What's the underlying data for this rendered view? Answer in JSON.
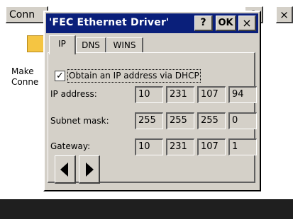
{
  "background": {
    "button_label": "Conn",
    "mid_button_label": "?",
    "close_label": "×",
    "icon_label_line1": "Make",
    "icon_label_line2": "Conne"
  },
  "dialog": {
    "title": "'FEC Ethernet Driver'",
    "help_label": "?",
    "ok_label": "OK",
    "close_label": "×"
  },
  "tabs": [
    {
      "label": "IP",
      "active": true
    },
    {
      "label": "DNS",
      "active": false
    },
    {
      "label": "WINS",
      "active": false
    }
  ],
  "dhcp": {
    "label": "Obtain an IP address via DHCP",
    "checked": true,
    "check_mark": "✓"
  },
  "fields": {
    "ip": {
      "label": "IP address:",
      "octets": [
        "10",
        "231",
        "107",
        "94"
      ]
    },
    "mask": {
      "label": "Subnet mask:",
      "octets": [
        "255",
        "255",
        "255",
        "0"
      ]
    },
    "gateway": {
      "label": "Gateway:",
      "octets": [
        "10",
        "231",
        "107",
        "1"
      ]
    }
  },
  "nav": {
    "prev_icon": "left-arrow-icon",
    "next_icon": "right-arrow-icon"
  },
  "colors": {
    "title_bar": "#0a1f7a",
    "dialog_face": "#d4d0c8",
    "taskbar": "#1f1f1f"
  }
}
